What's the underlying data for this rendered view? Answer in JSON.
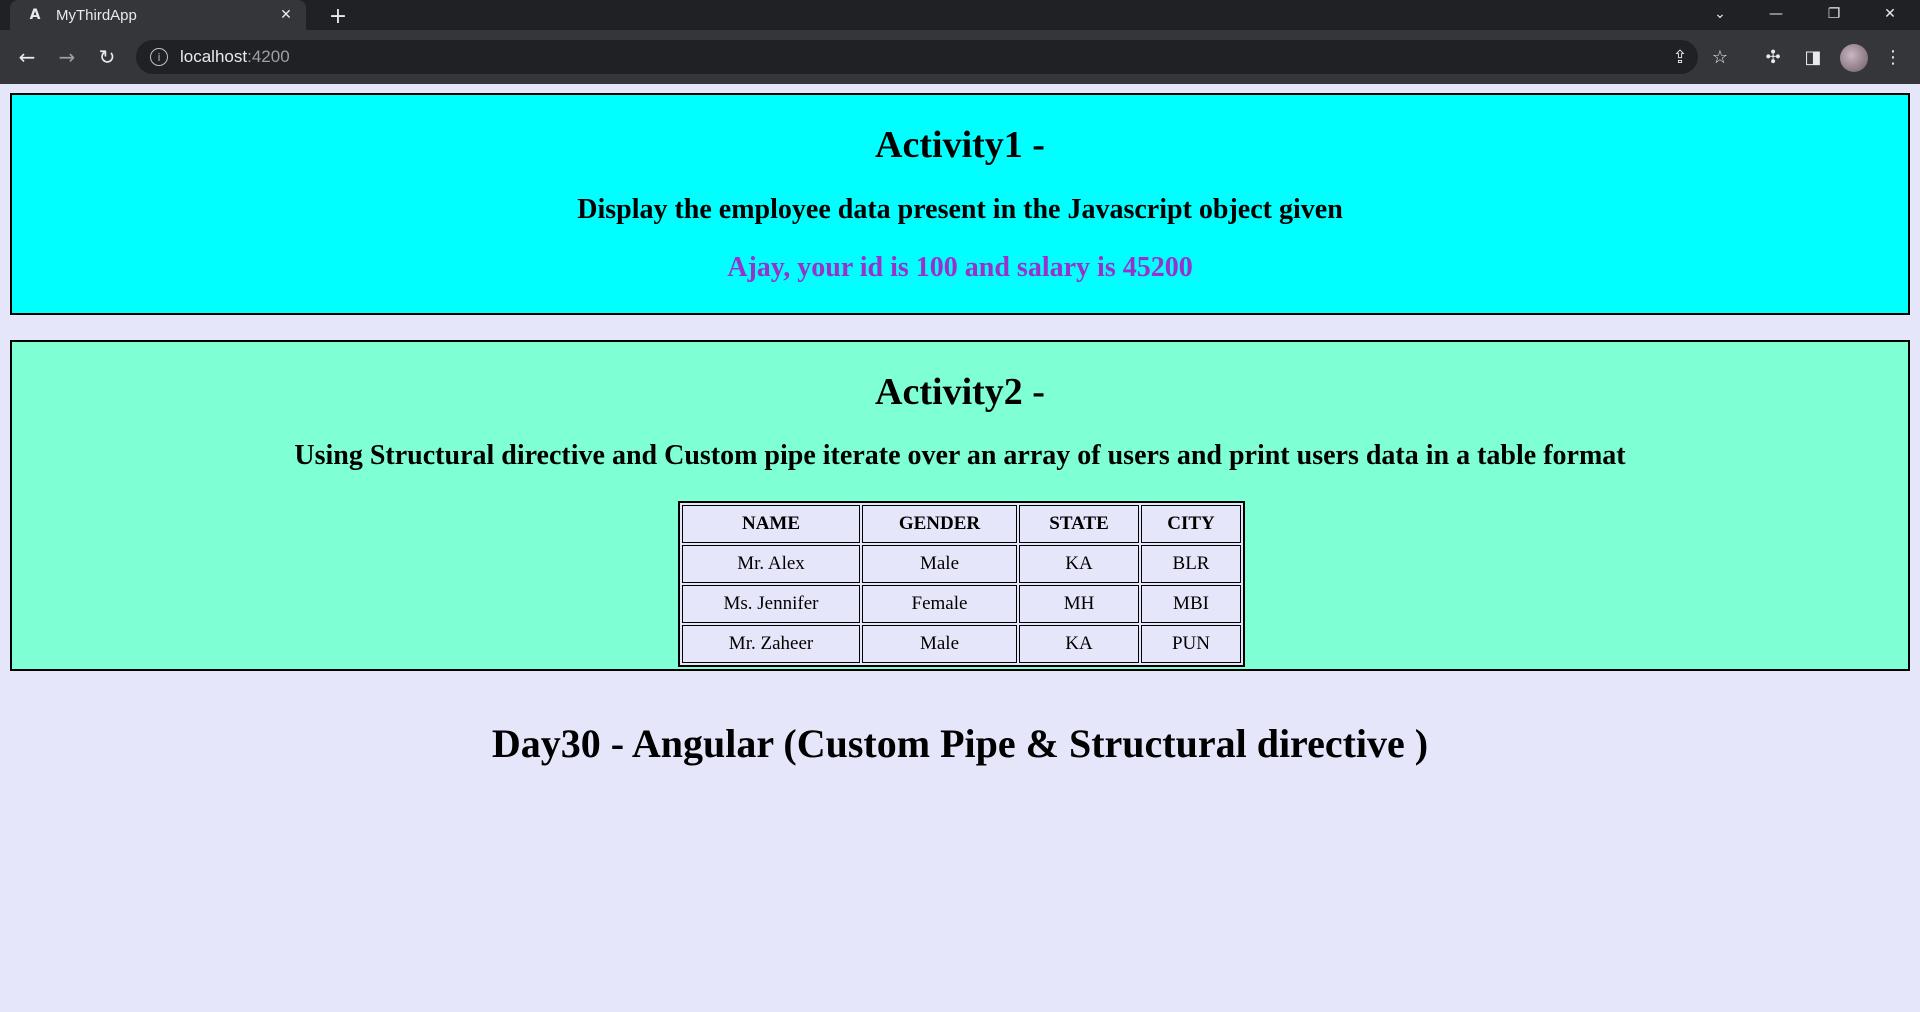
{
  "browser": {
    "tab_title": "MyThirdApp",
    "tab_favicon": "angular-icon",
    "url_host": "localhost",
    "url_port": ":4200"
  },
  "activity1": {
    "heading": "Activity1 -",
    "subheading": "Display the employee data present in the Javascript object given",
    "message": "Ajay, your id is 100 and salary is 45200",
    "message_color": "#9932cc",
    "bg_color": "#00ffff"
  },
  "activity2": {
    "heading": "Activity2 -",
    "subheading": "Using Structural directive and Custom pipe iterate over an array of users and print users data in a table format",
    "bg_color": "#7fffd4",
    "table": {
      "headers": [
        "NAME",
        "GENDER",
        "STATE",
        "CITY"
      ],
      "rows": [
        [
          "Mr. Alex",
          "Male",
          "KA",
          "BLR"
        ],
        [
          "Ms. Jennifer",
          "Female",
          "MH",
          "MBI"
        ],
        [
          "Mr. Zaheer",
          "Male",
          "KA",
          "PUN"
        ]
      ]
    }
  },
  "footer": {
    "title": "Day30 - Angular (Custom Pipe & Structural directive )"
  },
  "page_bg_color": "#e6e6fa"
}
